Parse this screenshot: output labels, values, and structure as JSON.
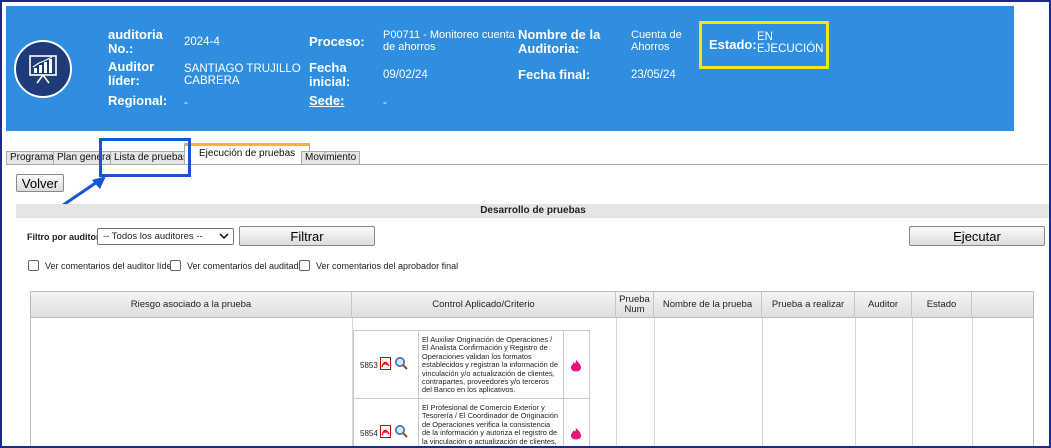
{
  "header": {
    "auditoria_label": "auditoria No.:",
    "auditoria_value": "2024-4",
    "auditor_lider_label": "Auditor líder:",
    "auditor_lider_value": "SANTIAGO TRUJILLO CABRERA",
    "regional_label": "Regional:",
    "regional_value": "-",
    "proceso_label": "Proceso:",
    "proceso_value": "P00711 - Monitoreo cuenta de ahorros",
    "fecha_inicial_label": "Fecha inicial:",
    "fecha_inicial_value": "09/02/24",
    "sede_label": "Sede:",
    "sede_value": "-",
    "nombre_auditoria_label": "Nombre de la Auditoria:",
    "nombre_auditoria_value": "Cuenta de Ahorros",
    "fecha_final_label": "Fecha final:",
    "fecha_final_value": "23/05/24",
    "estado_label": "Estado:",
    "estado_value": "EN EJECUCIÓN"
  },
  "tabs": [
    {
      "label": "Programa"
    },
    {
      "label": "Plan general"
    },
    {
      "label": "Lista de pruebas"
    },
    {
      "label": "Ejecución de pruebas"
    },
    {
      "label": "Movimiento"
    }
  ],
  "buttons": {
    "volver": "Volver",
    "filtrar": "Filtrar",
    "ejecutar": "Ejecutar"
  },
  "section_title": "Desarrollo de pruebas",
  "filter": {
    "label": "Filtro por auditor:",
    "selected": "-- Todos los auditores --"
  },
  "checkboxes": [
    {
      "label": "Ver comentarios del auditor líder"
    },
    {
      "label": "Ver comentarios del auditado"
    },
    {
      "label": "Ver comentarios del aprobador final"
    }
  ],
  "table": {
    "headers": [
      "Riesgo asociado a la prueba",
      "Control Aplicado/Criterio",
      "Prueba Num",
      "Nombre de la prueba",
      "Prueba a realizar",
      "Auditor",
      "Estado"
    ],
    "controls": [
      {
        "id": "5853",
        "text": "El Auxiliar Originación de Operaciones / El Analista Confirmación y Registro de Operaciones validan los formatos establecidos y registran la información de vinculación y/o actualización de clientes, contrapartes, proveedores y/o terceros del Banco en los aplicativos."
      },
      {
        "id": "5854",
        "text": "El Profesional de Comercio Exterior y Tesorería / El Coordinador de Originación de Operaciones verifica la consistencia de la información y autoriza el registro de la vinculación o actualización de clientes, contrapartes, proveedores y/o terceros"
      }
    ]
  },
  "colors": {
    "header_bg": "#2f8ee0",
    "estado_highlight": "#f5e60f",
    "annotation_blue": "#1455d9",
    "active_tab_accent": "#f4b14a"
  }
}
